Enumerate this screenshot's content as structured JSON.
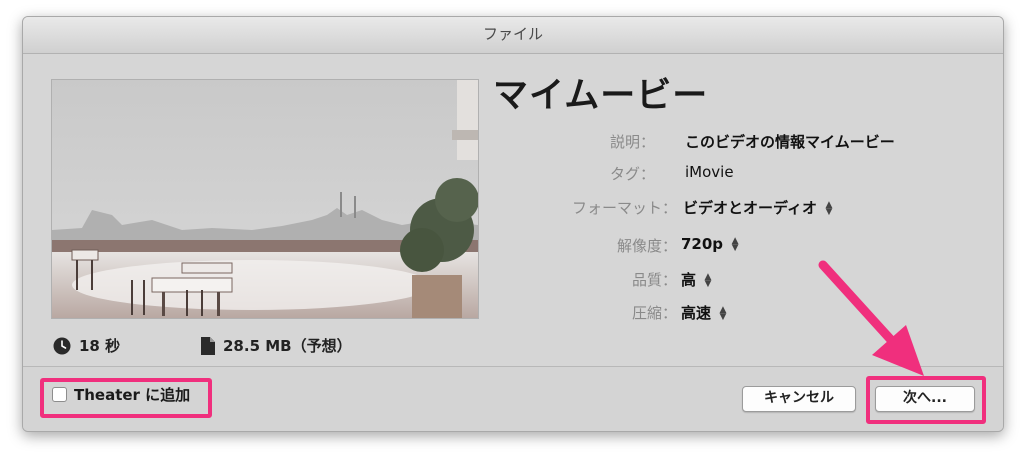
{
  "window": {
    "title": "ファイル"
  },
  "movie": {
    "title": "マイムービー"
  },
  "fields": [
    {
      "label": "説明：",
      "value": "このビデオの情報マイムービー",
      "stepper": false,
      "bold": true
    },
    {
      "label": "タグ：",
      "value": "iMovie",
      "stepper": false,
      "bold": false
    },
    {
      "label": "フォーマット：",
      "value": "ビデオとオーディオ",
      "stepper": true,
      "bold": true
    },
    {
      "label": "解像度：",
      "value": "720p",
      "stepper": true,
      "bold": true
    },
    {
      "label": "品質：",
      "value": "高",
      "stepper": true,
      "bold": true
    },
    {
      "label": "圧縮：",
      "value": "高速",
      "stepper": true,
      "bold": true
    }
  ],
  "info": {
    "duration": "18 秒",
    "size": "28.5 MB（予想）"
  },
  "footer": {
    "theater_checkbox_label": "Theater に追加",
    "theater_checked": false,
    "cancel_label": "キャンセル",
    "next_label": "次へ..."
  },
  "icons": {
    "duration": "clock-icon",
    "size": "file-icon",
    "stepper": "up-down-stepper-icon"
  },
  "colors": {
    "highlight": "#f02f7d",
    "dialog_bg": "#d6d6d6"
  }
}
